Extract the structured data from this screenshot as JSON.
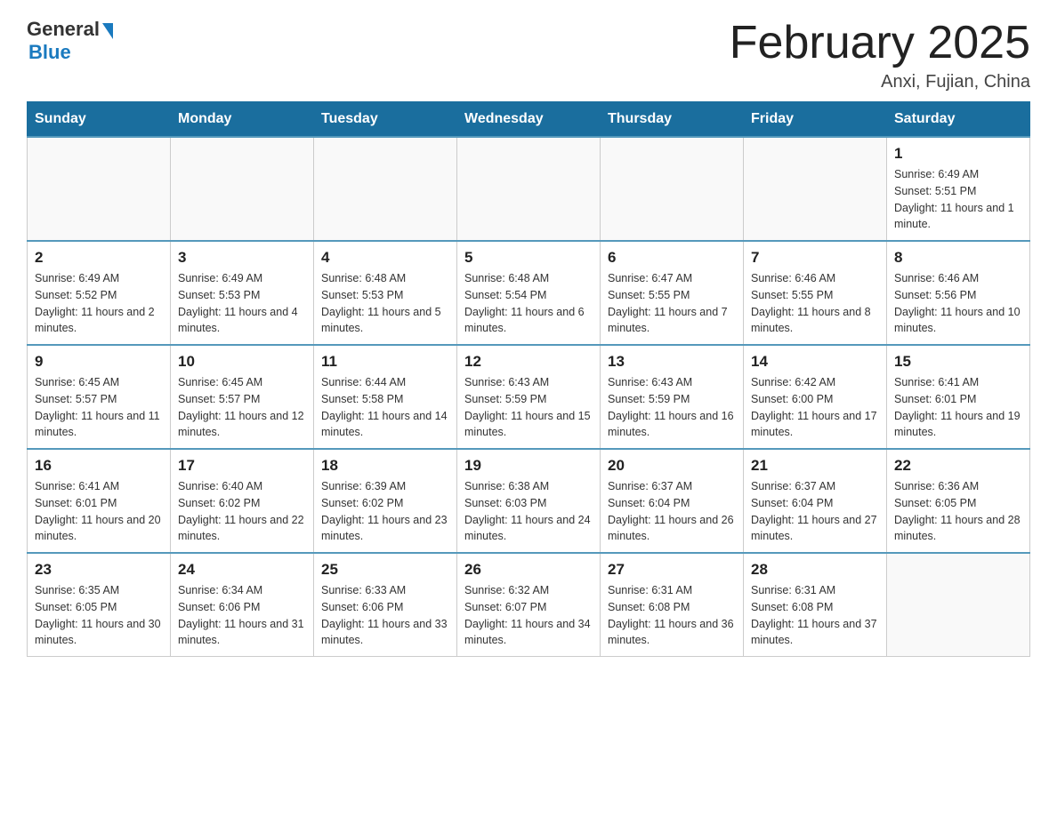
{
  "header": {
    "logo_general": "General",
    "logo_blue": "Blue",
    "month_title": "February 2025",
    "location": "Anxi, Fujian, China"
  },
  "days_of_week": [
    "Sunday",
    "Monday",
    "Tuesday",
    "Wednesday",
    "Thursday",
    "Friday",
    "Saturday"
  ],
  "weeks": [
    [
      {
        "day": "",
        "info": ""
      },
      {
        "day": "",
        "info": ""
      },
      {
        "day": "",
        "info": ""
      },
      {
        "day": "",
        "info": ""
      },
      {
        "day": "",
        "info": ""
      },
      {
        "day": "",
        "info": ""
      },
      {
        "day": "1",
        "info": "Sunrise: 6:49 AM\nSunset: 5:51 PM\nDaylight: 11 hours and 1 minute."
      }
    ],
    [
      {
        "day": "2",
        "info": "Sunrise: 6:49 AM\nSunset: 5:52 PM\nDaylight: 11 hours and 2 minutes."
      },
      {
        "day": "3",
        "info": "Sunrise: 6:49 AM\nSunset: 5:53 PM\nDaylight: 11 hours and 4 minutes."
      },
      {
        "day": "4",
        "info": "Sunrise: 6:48 AM\nSunset: 5:53 PM\nDaylight: 11 hours and 5 minutes."
      },
      {
        "day": "5",
        "info": "Sunrise: 6:48 AM\nSunset: 5:54 PM\nDaylight: 11 hours and 6 minutes."
      },
      {
        "day": "6",
        "info": "Sunrise: 6:47 AM\nSunset: 5:55 PM\nDaylight: 11 hours and 7 minutes."
      },
      {
        "day": "7",
        "info": "Sunrise: 6:46 AM\nSunset: 5:55 PM\nDaylight: 11 hours and 8 minutes."
      },
      {
        "day": "8",
        "info": "Sunrise: 6:46 AM\nSunset: 5:56 PM\nDaylight: 11 hours and 10 minutes."
      }
    ],
    [
      {
        "day": "9",
        "info": "Sunrise: 6:45 AM\nSunset: 5:57 PM\nDaylight: 11 hours and 11 minutes."
      },
      {
        "day": "10",
        "info": "Sunrise: 6:45 AM\nSunset: 5:57 PM\nDaylight: 11 hours and 12 minutes."
      },
      {
        "day": "11",
        "info": "Sunrise: 6:44 AM\nSunset: 5:58 PM\nDaylight: 11 hours and 14 minutes."
      },
      {
        "day": "12",
        "info": "Sunrise: 6:43 AM\nSunset: 5:59 PM\nDaylight: 11 hours and 15 minutes."
      },
      {
        "day": "13",
        "info": "Sunrise: 6:43 AM\nSunset: 5:59 PM\nDaylight: 11 hours and 16 minutes."
      },
      {
        "day": "14",
        "info": "Sunrise: 6:42 AM\nSunset: 6:00 PM\nDaylight: 11 hours and 17 minutes."
      },
      {
        "day": "15",
        "info": "Sunrise: 6:41 AM\nSunset: 6:01 PM\nDaylight: 11 hours and 19 minutes."
      }
    ],
    [
      {
        "day": "16",
        "info": "Sunrise: 6:41 AM\nSunset: 6:01 PM\nDaylight: 11 hours and 20 minutes."
      },
      {
        "day": "17",
        "info": "Sunrise: 6:40 AM\nSunset: 6:02 PM\nDaylight: 11 hours and 22 minutes."
      },
      {
        "day": "18",
        "info": "Sunrise: 6:39 AM\nSunset: 6:02 PM\nDaylight: 11 hours and 23 minutes."
      },
      {
        "day": "19",
        "info": "Sunrise: 6:38 AM\nSunset: 6:03 PM\nDaylight: 11 hours and 24 minutes."
      },
      {
        "day": "20",
        "info": "Sunrise: 6:37 AM\nSunset: 6:04 PM\nDaylight: 11 hours and 26 minutes."
      },
      {
        "day": "21",
        "info": "Sunrise: 6:37 AM\nSunset: 6:04 PM\nDaylight: 11 hours and 27 minutes."
      },
      {
        "day": "22",
        "info": "Sunrise: 6:36 AM\nSunset: 6:05 PM\nDaylight: 11 hours and 28 minutes."
      }
    ],
    [
      {
        "day": "23",
        "info": "Sunrise: 6:35 AM\nSunset: 6:05 PM\nDaylight: 11 hours and 30 minutes."
      },
      {
        "day": "24",
        "info": "Sunrise: 6:34 AM\nSunset: 6:06 PM\nDaylight: 11 hours and 31 minutes."
      },
      {
        "day": "25",
        "info": "Sunrise: 6:33 AM\nSunset: 6:06 PM\nDaylight: 11 hours and 33 minutes."
      },
      {
        "day": "26",
        "info": "Sunrise: 6:32 AM\nSunset: 6:07 PM\nDaylight: 11 hours and 34 minutes."
      },
      {
        "day": "27",
        "info": "Sunrise: 6:31 AM\nSunset: 6:08 PM\nDaylight: 11 hours and 36 minutes."
      },
      {
        "day": "28",
        "info": "Sunrise: 6:31 AM\nSunset: 6:08 PM\nDaylight: 11 hours and 37 minutes."
      },
      {
        "day": "",
        "info": ""
      }
    ]
  ]
}
